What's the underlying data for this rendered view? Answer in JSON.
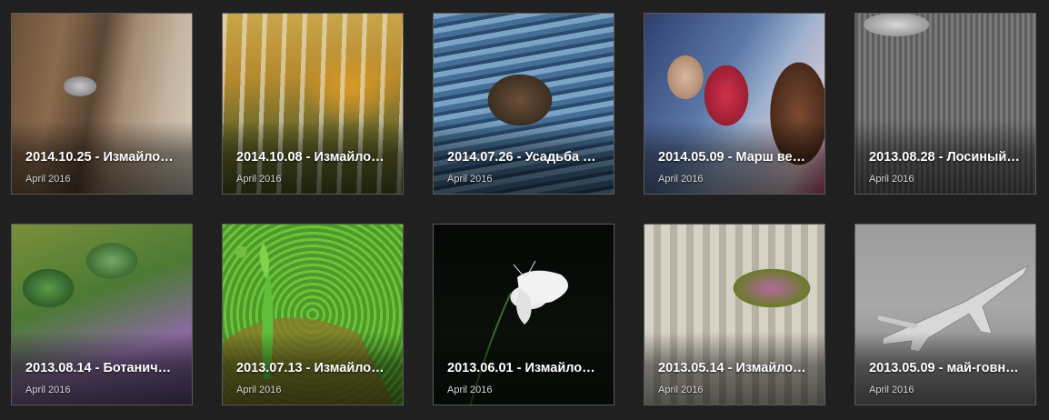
{
  "albums": [
    {
      "title": "2014.10.25 - Измайло…",
      "date": "April 2016",
      "photo": "bird-on-tree-trunk"
    },
    {
      "title": "2014.10.08 - Измайло…",
      "date": "April 2016",
      "photo": "autumn-birch-forest"
    },
    {
      "title": "2014.07.26 - Усадьба …",
      "date": "April 2016",
      "photo": "duck-on-water"
    },
    {
      "title": "2014.05.09 - Марш ве…",
      "date": "April 2016",
      "photo": "veteran-with-flowers"
    },
    {
      "title": "2013.08.28 - Лосиный…",
      "date": "April 2016",
      "photo": "insect-on-stump-bw"
    },
    {
      "title": "2013.08.14 - Ботанич…",
      "date": "April 2016",
      "photo": "hosta-garden-path"
    },
    {
      "title": "2013.07.13 - Измайло…",
      "date": "April 2016",
      "photo": "sprout-on-green-leaves"
    },
    {
      "title": "2013.06.01 - Измайло…",
      "date": "April 2016",
      "photo": "white-butterfly-dark"
    },
    {
      "title": "2013.05.14 - Измайло…",
      "date": "April 2016",
      "photo": "stone-flower-vases"
    },
    {
      "title": "2013.05.09 - май-говн…",
      "date": "April 2016",
      "photo": "jet-plane-bw"
    }
  ],
  "colors": {
    "background": "#202020",
    "tile_border": "#5a5a5a",
    "title_text": "#ffffff",
    "date_text": "#d7d7d7"
  }
}
